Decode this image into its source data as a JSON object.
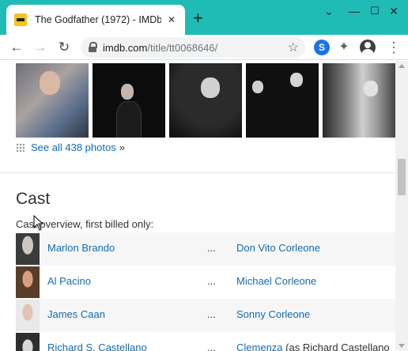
{
  "browser": {
    "tab_title": "The Godfather (1972) - IMDb",
    "tab_close": "✕",
    "new_tab": "+",
    "window_controls": [
      "⌄",
      "—",
      "☐",
      "✕"
    ],
    "back": "←",
    "forward": "→",
    "reload": "↻",
    "url_host": "imdb.com",
    "url_path": "/title/tt0068646/",
    "bookmark_star": "☆",
    "extension_letter": "S",
    "puzzle": "✦",
    "menu": "⋮"
  },
  "photos": {
    "see_all_label": "See all 438 photos",
    "see_all_arrow": "»"
  },
  "cast": {
    "title": "Cast",
    "subtitle": "Cast overview, first billed only:",
    "rows": [
      {
        "actor": "Marlon Brando",
        "ellipsis": "...",
        "character": "Don Vito Corleone",
        "note": ""
      },
      {
        "actor": "Al Pacino",
        "ellipsis": "...",
        "character": "Michael Corleone",
        "note": ""
      },
      {
        "actor": "James Caan",
        "ellipsis": "...",
        "character": "Sonny Corleone",
        "note": ""
      },
      {
        "actor": "Richard S. Castellano",
        "ellipsis": "...",
        "character": "Clemenza",
        "note": " (as Richard Castellano"
      }
    ]
  },
  "colors": {
    "tabbar": "#1fbcb6",
    "link": "#136cb2",
    "text": "#333333"
  }
}
